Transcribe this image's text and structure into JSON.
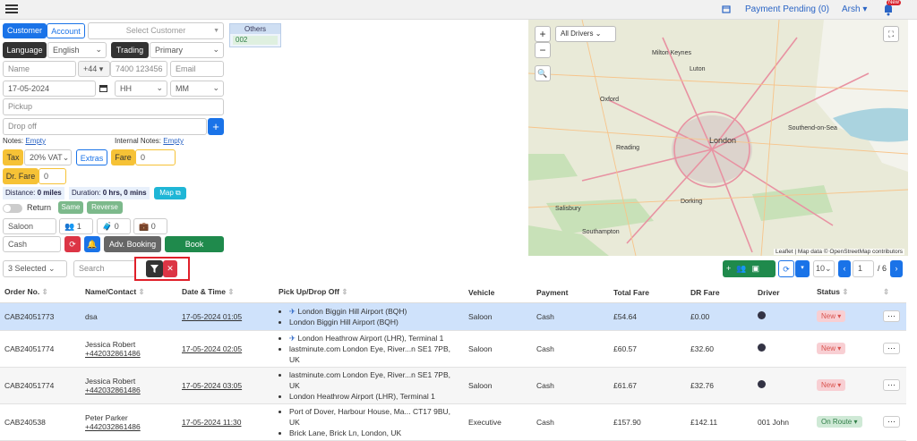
{
  "topbar": {
    "payment_pending": "Payment Pending (0)",
    "user": "Arsh",
    "bell_badge": "New"
  },
  "form": {
    "tabs": [
      "Customer",
      "Account"
    ],
    "select_customer": "Select Customer",
    "others_label": "Others",
    "others_value": "002",
    "language_label": "Language",
    "language_value": "English",
    "trading_label": "Trading",
    "trading_value": "Primary",
    "name_placeholder": "Name",
    "phone_code": "+44",
    "phone_placeholder": "7400 123456",
    "email_placeholder": "Email",
    "date": "17-05-2024",
    "hour": "HH",
    "minute": "MM",
    "pickup_placeholder": "Pickup",
    "dropoff_placeholder": "Drop off",
    "notes_label": "Notes:",
    "notes_value": "Empty",
    "internal_notes_label": "Internal Notes:",
    "internal_notes_value": "Empty",
    "tax_label": "Tax",
    "tax_value": "20% VAT",
    "extras_label": "Extras",
    "fare_label": "Fare",
    "fare_value": "0",
    "dr_fare_label": "Dr. Fare",
    "dr_fare_value": "0",
    "distance_label": "Distance:",
    "distance_value": "0 miles",
    "duration_label": "Duration:",
    "duration_value": "0 hrs, 0 mins",
    "map_label": "Map",
    "return_label": "Return",
    "same_label": "Same",
    "reverse_label": "Reverse",
    "vehicle": "Saloon",
    "passengers": "1",
    "luggage": "0",
    "hand_luggage": "0",
    "payment": "Cash",
    "adv_booking_label": "Adv. Booking",
    "book_label": "Book"
  },
  "map": {
    "drivers_select": "All Drivers",
    "attribution": "Leaflet | Map data © OpenStreetMap contributors",
    "places": [
      "London",
      "Oxford",
      "Milton Keynes",
      "Southend-on-Sea",
      "Salisbury",
      "Southampton",
      "Luton",
      "Reading",
      "Dorking"
    ]
  },
  "list_toolbar": {
    "selected": "3 Selected",
    "search_placeholder": "Search",
    "per_page": "10",
    "page": "1",
    "total_pages": "/ 6"
  },
  "table": {
    "headers": [
      "Order No.",
      "Name/Contact",
      "Date & Time",
      "Pick Up/Drop Off",
      "Vehicle",
      "Payment",
      "Total Fare",
      "DR Fare",
      "Driver",
      "Status"
    ],
    "rows": [
      {
        "order": "CAB24051773",
        "name": "dsa",
        "phone": "",
        "datetime": "17-05-2024 01:05",
        "pickup": "London Biggin Hill Airport (BQH)",
        "dropoff": "London Biggin Hill Airport (BQH)",
        "vehicle": "Saloon",
        "payment": "Cash",
        "total": "£54.64",
        "dr": "£0.00",
        "driver": "",
        "status": "New"
      },
      {
        "order": "CAB24051774",
        "name": "Jessica Robert",
        "phone": "+442032861486",
        "datetime": "17-05-2024 02:05",
        "pickup": "London Heathrow Airport (LHR), Terminal 1",
        "dropoff": "lastminute.com London Eye, River...n SE1 7PB, UK",
        "vehicle": "Saloon",
        "payment": "Cash",
        "total": "£60.57",
        "dr": "£32.60",
        "driver": "",
        "status": "New"
      },
      {
        "order": "CAB24051774",
        "name": "Jessica Robert",
        "phone": "+442032861486",
        "datetime": "17-05-2024 03:05",
        "pickup": "lastminute.com London Eye, River...n SE1 7PB, UK",
        "dropoff": "London Heathrow Airport (LHR), Terminal 1",
        "vehicle": "Saloon",
        "payment": "Cash",
        "total": "£61.67",
        "dr": "£32.76",
        "driver": "",
        "status": "New"
      },
      {
        "order": "CAB240538",
        "name": "Peter Parker",
        "phone": "+442032861486",
        "datetime": "17-05-2024 11:30",
        "pickup": "Port of Dover, Harbour House, Ma... CT17 9BU, UK",
        "dropoff": "Brick Lane, Brick Ln, London, UK",
        "vehicle": "Executive",
        "payment": "Cash",
        "total": "£157.90",
        "dr": "£142.11",
        "driver": "001 John",
        "status": "On Route"
      }
    ]
  }
}
